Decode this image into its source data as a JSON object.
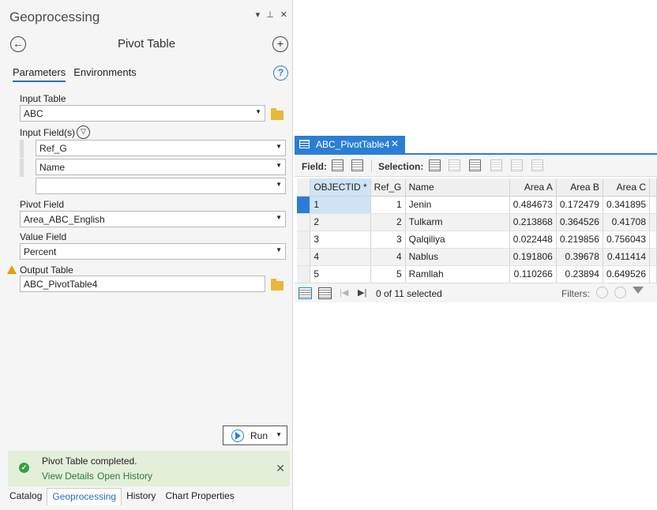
{
  "pane": {
    "title": "Geoprocessing",
    "controls": [
      "▾",
      "⊥",
      "✕"
    ]
  },
  "tool": {
    "title": "Pivot Table",
    "back_icon": "arrow-left-circle-icon",
    "add_icon": "plus-circle-icon"
  },
  "tabs": [
    "Parameters",
    "Environments"
  ],
  "params": {
    "input_table_label": "Input Table",
    "input_table_value": "ABC",
    "input_fields_label": "Input Field(s)",
    "input_fields": [
      "Ref_G",
      "Name",
      ""
    ],
    "pivot_field_label": "Pivot Field",
    "pivot_field_value": "Area_ABC_English",
    "value_field_label": "Value Field",
    "value_field_value": "Percent",
    "output_table_label": "Output Table",
    "output_table_value": "ABC_PivotTable4"
  },
  "run_label": "Run",
  "status": {
    "message": "Pivot Table completed.",
    "view_details": "View Details",
    "open_history": "Open History"
  },
  "bottom_tabs": [
    "Catalog",
    "Geoprocessing",
    "History",
    "Chart Properties"
  ],
  "table_view": {
    "tab_label": "ABC_PivotTable4",
    "field_label": "Field:",
    "selection_label": "Selection:",
    "columns": [
      "OBJECTID *",
      "Ref_G",
      "Name",
      "Area A",
      "Area B",
      "Area C"
    ],
    "rows": [
      [
        "1",
        "1",
        "Jenin",
        "0.484673",
        "0.172479",
        "0.341895"
      ],
      [
        "2",
        "2",
        "Tulkarm",
        "0.213868",
        "0.364526",
        "0.41708"
      ],
      [
        "3",
        "3",
        "Qalqiliya",
        "0.022448",
        "0.219856",
        "0.756043"
      ],
      [
        "4",
        "4",
        "Nablus",
        "0.191806",
        "0.39678",
        "0.411414"
      ],
      [
        "5",
        "5",
        "Ramllah",
        "0.110266",
        "0.23894",
        "0.649526"
      ]
    ],
    "selection_status": "0 of 11 selected",
    "filters_label": "Filters:"
  },
  "colors": {
    "accent": "#2a7fd4",
    "status_bg": "#e3efd9",
    "success": "#35a043",
    "warning": "#e0a100"
  }
}
